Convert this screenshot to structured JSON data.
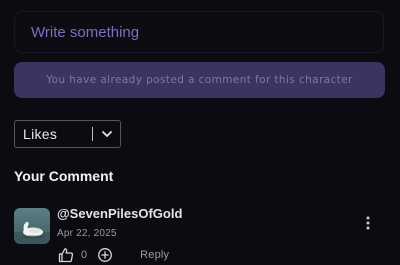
{
  "comment_input": {
    "placeholder": "Write something",
    "value": ""
  },
  "notice": {
    "text": "You have already posted a comment for this character"
  },
  "sort": {
    "selected": "Likes",
    "icon": "chevron-down-icon"
  },
  "section": {
    "title": "Your Comment"
  },
  "comment": {
    "username": "@SevenPilesOfGold",
    "date": "Apr 22, 2025",
    "avatar": "swan-avatar",
    "like_count": "0",
    "reply_label": "Reply",
    "icons": {
      "like": "thumbs-up-icon",
      "add": "plus-circle-icon",
      "more": "more-vertical-icon"
    }
  },
  "colors": {
    "background": "#0c0b11",
    "notice_bg": "#3b3361",
    "notice_text": "#7f76a6",
    "placeholder": "#7c6fbd"
  }
}
